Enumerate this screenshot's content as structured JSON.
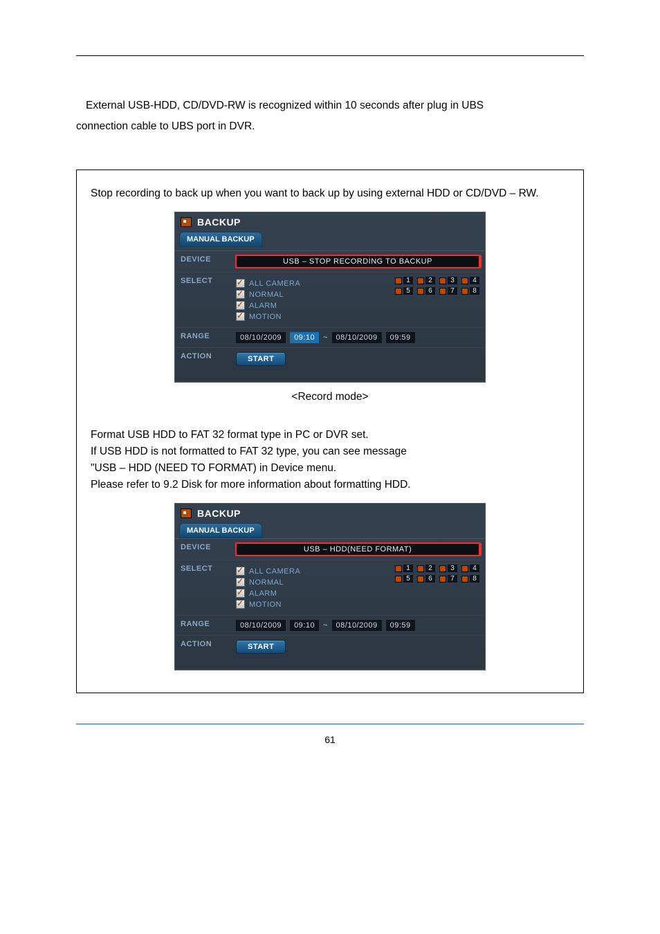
{
  "intro": {
    "l1": "External USB-HDD, CD/DVD-RW is recognized within 10 seconds after plug in UBS",
    "l2": "connection cable to UBS port in DVR."
  },
  "callout": {
    "p1": "Stop recording to back up when you want to back up by using external HDD or CD/DVD – RW."
  },
  "panel1": {
    "title": "BACKUP",
    "tab": "MANUAL BACKUP",
    "rows": {
      "device_label": "DEVICE",
      "device_value": "USB – STOP RECORDING TO BACKUP",
      "select_label": "SELECT",
      "all_camera": "ALL CAMERA",
      "normal": "NORMAL",
      "alarm": "ALARM",
      "motion": "MOTION",
      "range_label": "RANGE",
      "range_from_date": "08/10/2009",
      "range_from_time": "09:10",
      "range_to_date": "08/10/2009",
      "range_to_time": "09:59",
      "tilde": "~",
      "action_label": "ACTION",
      "start": "START"
    },
    "cams": [
      "1",
      "2",
      "3",
      "4",
      "5",
      "6",
      "7",
      "8"
    ]
  },
  "caption1": "<Record mode>",
  "mid": {
    "l1": "Format USB HDD to FAT 32 format type in PC or DVR set.",
    "l2": "If USB HDD is not formatted to FAT 32 type, you can see message",
    "l3": "\"USB – HDD (NEED TO FORMAT) in Device menu.",
    "l4": "Please refer to 9.2 Disk for more information about formatting HDD."
  },
  "panel2": {
    "title": "BACKUP",
    "tab": "MANUAL BACKUP",
    "rows": {
      "device_label": "DEVICE",
      "device_value": "USB – HDD(NEED FORMAT)",
      "select_label": "SELECT",
      "all_camera": "ALL CAMERA",
      "normal": "NORMAL",
      "alarm": "ALARM",
      "motion": "MOTION",
      "range_label": "RANGE",
      "range_from_date": "08/10/2009",
      "range_from_time": "09:10",
      "range_to_date": "08/10/2009",
      "range_to_time": "09:59",
      "tilde": "~",
      "action_label": "ACTION",
      "start": "START"
    },
    "cams": [
      "1",
      "2",
      "3",
      "4",
      "5",
      "6",
      "7",
      "8"
    ]
  },
  "pagenum": "61"
}
